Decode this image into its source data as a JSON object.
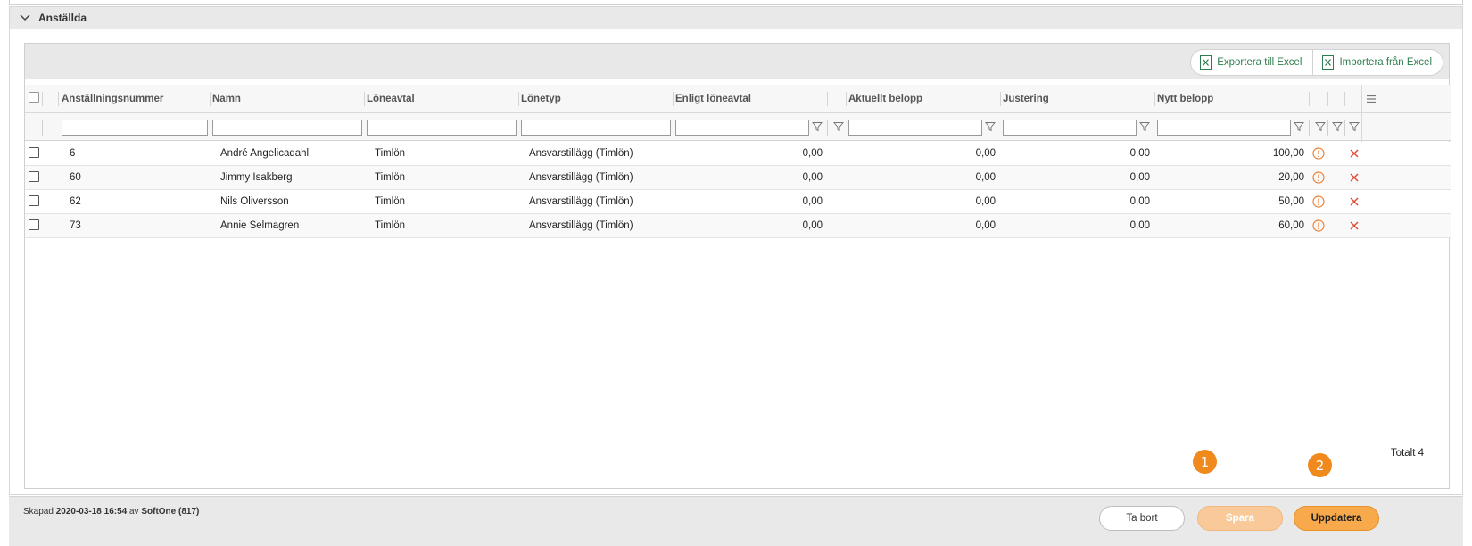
{
  "panel": {
    "title": "Anställda"
  },
  "toolbar": {
    "export_label": "Exportera till Excel",
    "import_label": "Importera från Excel"
  },
  "columns": {
    "empno": "Anställningsnummer",
    "name": "Namn",
    "agreement": "Löneavtal",
    "wagetype": "Lönetyp",
    "by_agreement": "Enligt löneavtal",
    "current": "Aktuellt belopp",
    "adjustment": "Justering",
    "new_amount": "Nytt belopp"
  },
  "rows": [
    {
      "empno": "6",
      "name": "André Angelicadahl",
      "agreement": "Timlön",
      "wagetype": "Ansvarstillägg (Timlön)",
      "by_agreement": "0,00",
      "current": "0,00",
      "adjustment": "0,00",
      "new_amount": "100,00"
    },
    {
      "empno": "60",
      "name": "Jimmy Isakberg",
      "agreement": "Timlön",
      "wagetype": "Ansvarstillägg (Timlön)",
      "by_agreement": "0,00",
      "current": "0,00",
      "adjustment": "0,00",
      "new_amount": "20,00"
    },
    {
      "empno": "62",
      "name": "Nils Oliversson",
      "agreement": "Timlön",
      "wagetype": "Ansvarstillägg (Timlön)",
      "by_agreement": "0,00",
      "current": "0,00",
      "adjustment": "0,00",
      "new_amount": "50,00"
    },
    {
      "empno": "73",
      "name": "Annie Selmagren",
      "agreement": "Timlön",
      "wagetype": "Ansvarstillägg (Timlön)",
      "by_agreement": "0,00",
      "current": "0,00",
      "adjustment": "0,00",
      "new_amount": "60,00"
    }
  ],
  "grid_footer": {
    "total": "Totalt 4"
  },
  "footer": {
    "created_prefix": "Skapad",
    "created_date": "2020-03-18 16:54",
    "created_by_word": "av",
    "created_by": "SoftOne (817)",
    "delete_label": "Ta bort",
    "save_label": "Spara",
    "update_label": "Uppdatera"
  },
  "badges": {
    "first": "1",
    "second": "2"
  },
  "colors": {
    "accent": "#f08a1c",
    "excel_green": "#2e7d4f",
    "delete_red": "#e0452b",
    "info_orange": "#e8833a"
  }
}
